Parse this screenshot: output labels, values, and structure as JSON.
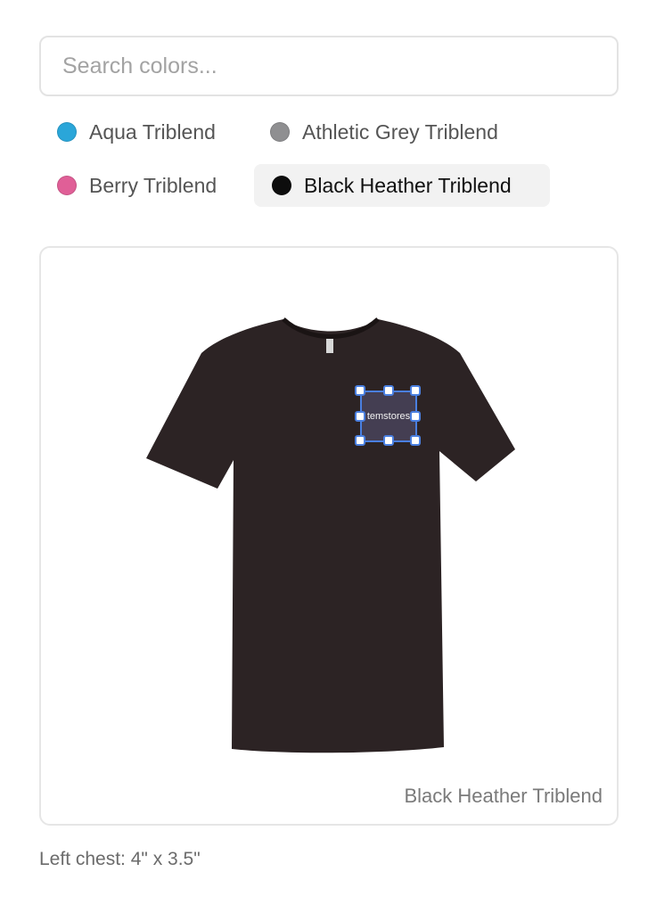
{
  "search": {
    "placeholder": "Search colors...",
    "value": ""
  },
  "colors": [
    {
      "label": "Aqua Triblend",
      "swatch": "#2aa6d9",
      "selected": false
    },
    {
      "label": "Athletic Grey Triblend",
      "swatch": "#8f8f91",
      "selected": false
    },
    {
      "label": "Berry Triblend",
      "swatch": "#e05f97",
      "selected": false
    },
    {
      "label": "Black Heather Triblend",
      "swatch": "#0d0d0d",
      "selected": true
    }
  ],
  "preview": {
    "shirt_color": "#2c2324",
    "caption": "Black Heather Triblend",
    "design_text": "temstores",
    "selection_color": "#4a7fe0"
  },
  "placement_note": "Left chest: 4\" x 3.5\""
}
